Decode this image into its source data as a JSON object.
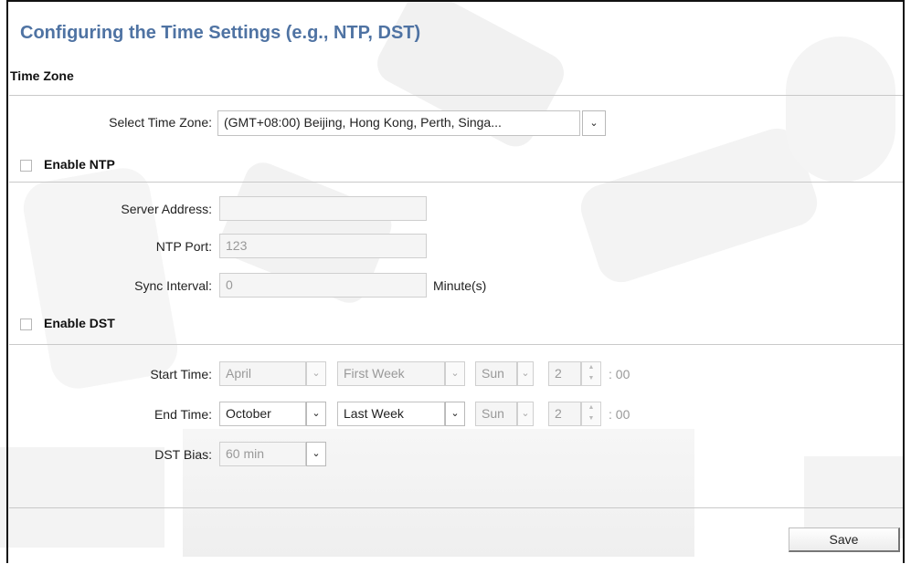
{
  "page": {
    "title": "Configuring the Time Settings (e.g., NTP, DST)"
  },
  "time_zone": {
    "section_title": "Time Zone",
    "select_label": "Select Time Zone:",
    "selected_value": "(GMT+08:00) Beijing, Hong Kong, Perth, Singa..."
  },
  "ntp": {
    "checkbox_label": "Enable NTP",
    "enabled": false,
    "server_address_label": "Server Address:",
    "server_address_value": "",
    "port_label": "NTP Port:",
    "port_value": "123",
    "sync_interval_label": "Sync Interval:",
    "sync_interval_value": "0",
    "sync_interval_unit": "Minute(s)"
  },
  "dst": {
    "checkbox_label": "Enable DST",
    "enabled": false,
    "start_time_label": "Start Time:",
    "start_month": "April",
    "start_week": "First Week",
    "start_day": "Sun",
    "start_hour": "2",
    "start_suffix": ": 00",
    "end_time_label": "End Time:",
    "end_month": "October",
    "end_week": "Last Week",
    "end_day": "Sun",
    "end_hour": "2",
    "end_suffix": ": 00",
    "bias_label": "DST Bias:",
    "bias_value": "60 min"
  },
  "actions": {
    "save_label": "Save"
  },
  "colors": {
    "title": "#4f73a3",
    "divider": "#c9c9c9",
    "disabled_field": "#f5f5f5"
  },
  "icons": {
    "dropdown": "chevron-down-icon",
    "spinner_up": "caret-up-icon",
    "spinner_down": "caret-down-icon"
  }
}
